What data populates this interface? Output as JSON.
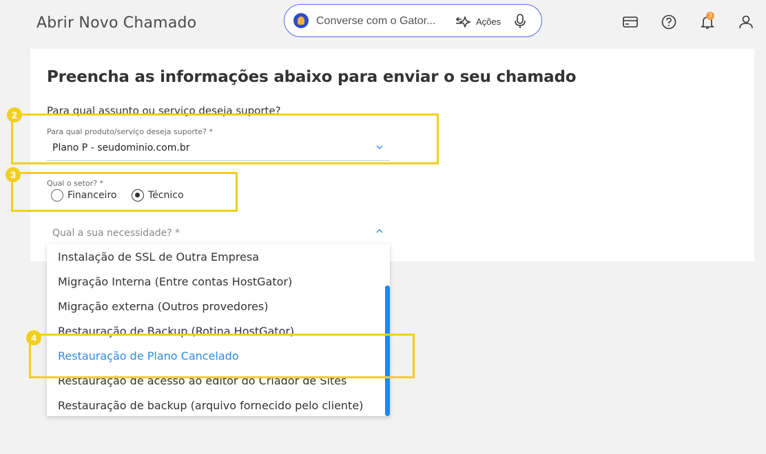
{
  "header": {
    "title": "Abrir Novo Chamado",
    "gator_placeholder": "Converse com o Gator...",
    "actions_label": "Ações",
    "notification_count": "3"
  },
  "form": {
    "heading": "Preencha as informações abaixo para enviar o seu chamado",
    "subject_question": "Para qual assunto ou serviço deseja suporte?",
    "product_label": "Para qual produto/serviço deseja suporte? *",
    "product_value": "Plano P - seudominio.com.br",
    "sector_label": "Qual o setor? *",
    "sector_options": [
      {
        "label": "Financeiro",
        "checked": false
      },
      {
        "label": "Técnico",
        "checked": true
      }
    ],
    "need_label": "Qual a sua necessidade? *"
  },
  "dropdown": {
    "options": [
      "Instalação de SSL de Outra Empresa",
      "Migração Interna (Entre contas HostGator)",
      "Migração externa (Outros provedores)",
      "Restauração de Backup (Rotina HostGator)",
      "Restauração de Plano Cancelado",
      "Restauração de acesso ao editor do Criador de Sites",
      "Restauração de backup (arquivo fornecido pelo cliente)"
    ],
    "selected": "Restauração de Plano Cancelado"
  },
  "annotations": [
    "2",
    "3",
    "4"
  ],
  "colors": {
    "accent": "#4f6bd8",
    "highlight": "#f2cf1f",
    "option_active": "#2d8be6",
    "badge": "#f59c3d"
  }
}
